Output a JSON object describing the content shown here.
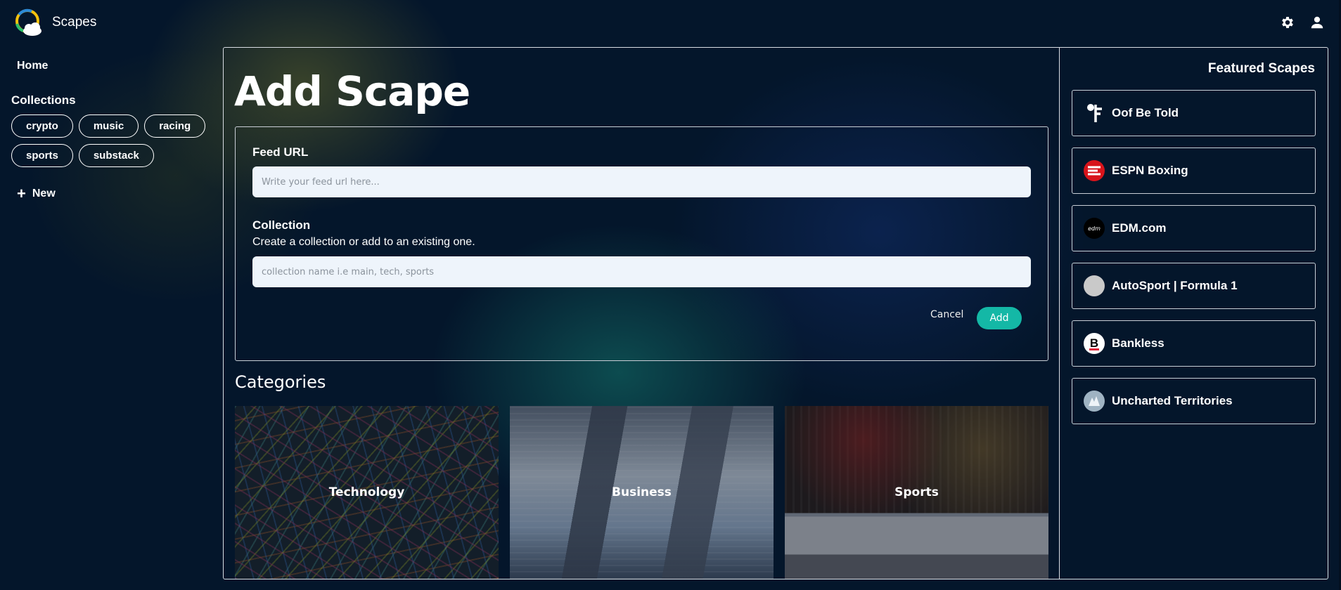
{
  "app": {
    "title": "Scapes"
  },
  "header": {
    "settings_icon": "gear-icon",
    "profile_icon": "user-icon"
  },
  "sidebar": {
    "home_label": "Home",
    "collections_heading": "Collections",
    "collections": [
      "crypto",
      "music",
      "racing",
      "sports",
      "substack"
    ],
    "new_label": "New"
  },
  "main": {
    "title": "Add Scape",
    "form": {
      "feed_url_label": "Feed URL",
      "feed_url_placeholder": "Write your feed url here...",
      "feed_url_value": "",
      "collection_label": "Collection",
      "collection_help": "Create a collection or add to an existing one.",
      "collection_placeholder": "collection name i.e main, tech, sports",
      "collection_value": "",
      "cancel_label": "Cancel",
      "add_label": "Add"
    },
    "categories_heading": "Categories",
    "categories": [
      "Technology",
      "Business",
      "Sports"
    ]
  },
  "featured": {
    "heading": "Featured Scapes",
    "items": [
      {
        "label": "Oof Be Told",
        "icon": "oof-be-told-logo-icon"
      },
      {
        "label": "ESPN Boxing",
        "icon": "espn-logo-icon"
      },
      {
        "label": "EDM.com",
        "icon": "edm-logo-icon"
      },
      {
        "label": "AutoSport | Formula 1",
        "icon": "autosport-logo-icon"
      },
      {
        "label": "Bankless",
        "icon": "bankless-logo-icon"
      },
      {
        "label": "Uncharted Territories",
        "icon": "uncharted-territories-logo-icon"
      }
    ]
  },
  "colors": {
    "accent": "#14b8a6",
    "background": "#04162b",
    "input_bg": "#eef4fb"
  }
}
